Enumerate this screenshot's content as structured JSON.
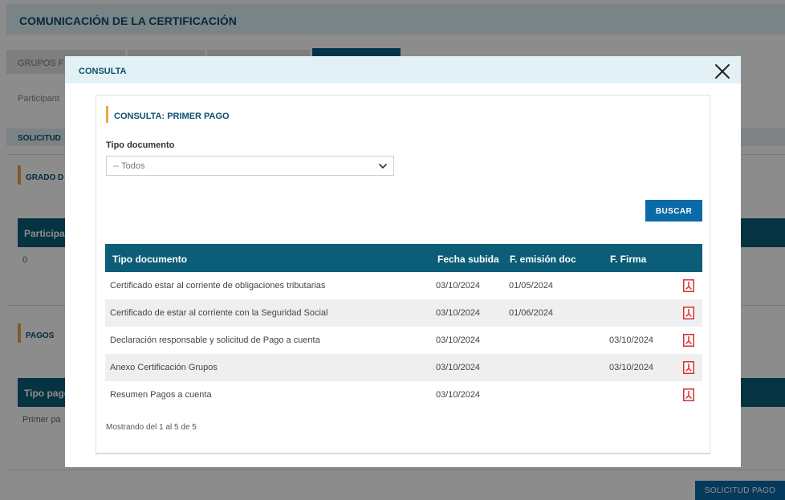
{
  "background": {
    "header_title": "COMUNICACIÓN DE LA CERTIFICACIÓN",
    "tabs": [
      "GRUPOS F",
      "",
      "",
      ""
    ],
    "participant_label": "Participant",
    "solicitud_label": "SOLICITUD",
    "grado_label": "GRADO D",
    "table1_head": "Participan",
    "table1_value": "0",
    "pagos_label": "PAGOS",
    "table2_head": "Tipo pago",
    "table2_value": "Primer pa",
    "solicitud_pago_button": "SOLICITUD PAGO"
  },
  "modal": {
    "title": "CONSULTA",
    "section_title": "CONSULTA: PRIMER PAGO",
    "filter": {
      "label": "Tipo documento",
      "selected": "-- Todos"
    },
    "search_button": "BUSCAR",
    "table": {
      "columns": [
        "Tipo documento",
        "Fecha subida",
        "F. emisión doc",
        "F. Firma"
      ],
      "rows": [
        {
          "tipo": "Certificado estar al corriente de obligaciones tributarias",
          "fecha_subida": "03/10/2024",
          "emision": "01/05/2024",
          "firma": ""
        },
        {
          "tipo": "Certificado de estar al corriente con la Seguridad Social",
          "fecha_subida": "03/10/2024",
          "emision": "01/06/2024",
          "firma": ""
        },
        {
          "tipo": "Declaración responsable y solicitud de Pago a cuenta",
          "fecha_subida": "03/10/2024",
          "emision": "",
          "firma": "03/10/2024"
        },
        {
          "tipo": "Anexo Certificación Grupos",
          "fecha_subida": "03/10/2024",
          "emision": "",
          "firma": "03/10/2024"
        },
        {
          "tipo": "Resumen Pagos a cuenta",
          "fecha_subida": "03/10/2024",
          "emision": "",
          "firma": ""
        }
      ]
    },
    "footer_info": "Mostrando del 1 al 5 de 5"
  },
  "colors": {
    "primary": "#0b5d78",
    "button": "#0b6aa8",
    "accent": "#f0a848",
    "pdf": "#d32f2f"
  },
  "icons": {
    "close": "close-icon",
    "chevron": "chevron-down-icon",
    "pdf": "pdf-icon"
  }
}
